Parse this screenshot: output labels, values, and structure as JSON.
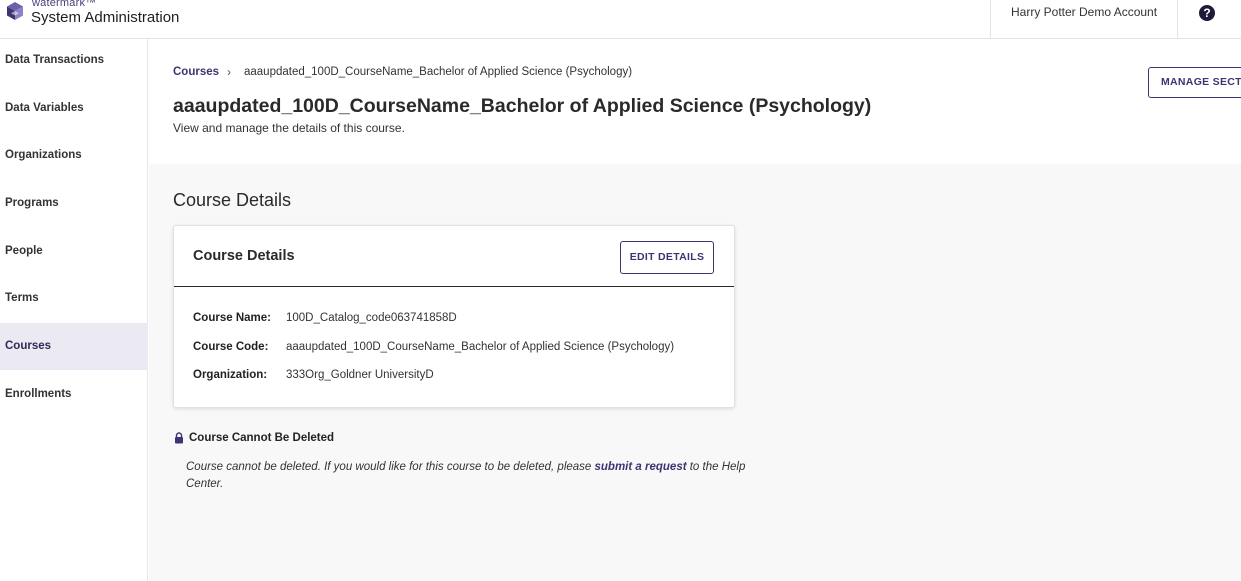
{
  "brand": {
    "small": "watermark™",
    "title": "System Administration"
  },
  "account": {
    "name": "Harry Potter Demo Account",
    "help_glyph": "?"
  },
  "sidebar": {
    "items": [
      {
        "label": "Data Transactions",
        "active": false
      },
      {
        "label": "Data Variables",
        "active": false
      },
      {
        "label": "Organizations",
        "active": false
      },
      {
        "label": "Programs",
        "active": false
      },
      {
        "label": "People",
        "active": false
      },
      {
        "label": "Terms",
        "active": false
      },
      {
        "label": "Courses",
        "active": true
      },
      {
        "label": "Enrollments",
        "active": false
      }
    ]
  },
  "breadcrumb": {
    "link": "Courses",
    "separator": "›",
    "current": "aaaupdated_100D_CourseName_Bachelor of Applied Science (Psychology)"
  },
  "page": {
    "title": "aaaupdated_100D_CourseName_Bachelor of Applied Science (Psychology)",
    "subtitle": "View and manage the details of this course.",
    "manage_label": "MANAGE SECTIONS"
  },
  "details": {
    "section_title": "Course Details",
    "card_title": "Course Details",
    "edit_label": "EDIT DETAILS",
    "rows": [
      {
        "label": "Course Name:",
        "value": "100D_Catalog_code063741858D"
      },
      {
        "label": "Course Code:",
        "value": "aaaupdated_100D_CourseName_Bachelor of Applied Science (Psychology)"
      },
      {
        "label": "Organization:",
        "value": "333Org_Goldner UniversityD"
      }
    ]
  },
  "warning": {
    "title": "Course Cannot Be Deleted",
    "text_before": "Course cannot be deleted. If you would like for this course to be deleted, please ",
    "link": "submit a request",
    "text_after": " to the Help Center."
  },
  "colors": {
    "accent": "#3d3571",
    "active_nav_bg": "#ebe9f1",
    "content_bg": "#f8f8f8"
  }
}
